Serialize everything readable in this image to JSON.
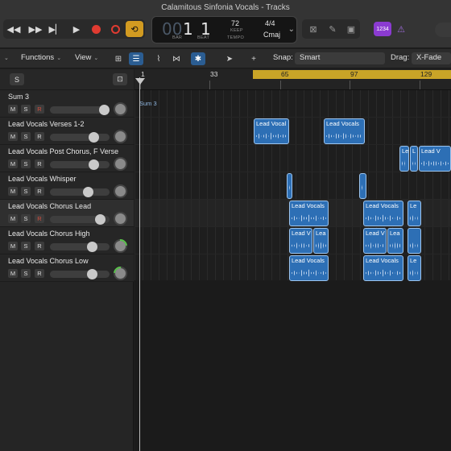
{
  "window": {
    "title": "Calamitous Sinfonia Vocals - Tracks"
  },
  "lcd": {
    "bar": "1",
    "beat": "1",
    "bar_label": "BAR",
    "beat_label": "BEAT",
    "tempo": "72",
    "keep": "KEEP",
    "tempo_label": "TEMPO",
    "signature": "4/4",
    "key": "Cmaj",
    "dim_digits": "00"
  },
  "count_in": "1234",
  "toolbar": {
    "functions": "Functions",
    "view": "View",
    "snap_label": "Snap:",
    "snap_value": "Smart",
    "drag_label": "Drag:",
    "drag_value": "X-Fade"
  },
  "track_header": {
    "solo_label": "S"
  },
  "ruler": {
    "bars": [
      "1",
      "33",
      "65",
      "97",
      "129"
    ]
  },
  "tracks": [
    {
      "name": "Sum 3",
      "m": "M",
      "s": "S",
      "r": "R"
    },
    {
      "name": "Lead Vocals Verses 1-2",
      "m": "M",
      "s": "S",
      "r": "R"
    },
    {
      "name": "Lead Vocals Post Chorus, F Verse",
      "m": "M",
      "s": "S",
      "r": "R"
    },
    {
      "name": "Lead Vocals Whisper",
      "m": "M",
      "s": "S",
      "r": "R"
    },
    {
      "name": "Lead Vocals Chorus Lead",
      "m": "M",
      "s": "S",
      "r": "R"
    },
    {
      "name": "Lead Vocals Chorus High",
      "m": "M",
      "s": "S",
      "r": "R"
    },
    {
      "name": "Lead Vocals Chorus Low",
      "m": "M",
      "s": "S",
      "r": "R"
    }
  ],
  "lanes": {
    "sum_label": "Sum 3",
    "regions": [
      {
        "label": "Lead Vocal"
      },
      {
        "label": "Lead Vocals"
      },
      {
        "label": "Le"
      },
      {
        "label": "L"
      },
      {
        "label": "Lead V"
      },
      {
        "label": ""
      },
      {
        "label": ""
      },
      {
        "label": "Lead Vocals"
      },
      {
        "label": "Lead Vocals"
      },
      {
        "label": "Le"
      },
      {
        "label": "Lead V"
      },
      {
        "label": "Lea"
      },
      {
        "label": "Lead V"
      },
      {
        "label": "Lea"
      },
      {
        "label": ""
      },
      {
        "label": "Lead Vocals"
      },
      {
        "label": "Lead Vocals"
      },
      {
        "label": "Le"
      }
    ]
  }
}
